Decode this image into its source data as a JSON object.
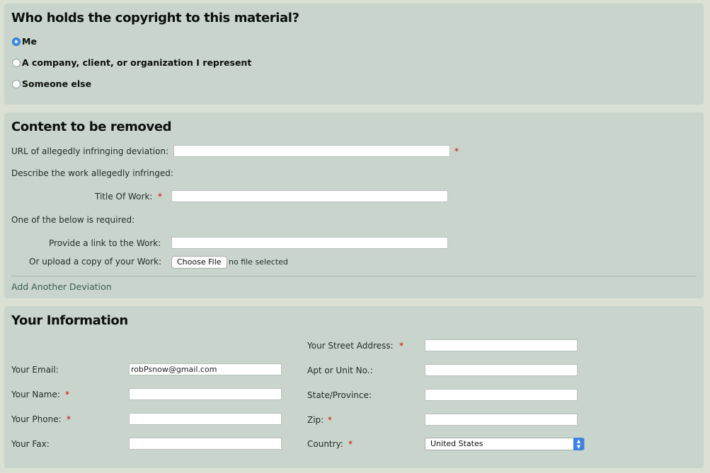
{
  "copyright": {
    "heading": "Who holds the copyright to this material?",
    "options": [
      {
        "label": "Me",
        "selected": true
      },
      {
        "label": "A company, client, or organization I represent",
        "selected": false
      },
      {
        "label": "Someone else",
        "selected": false
      }
    ]
  },
  "content": {
    "heading": "Content to be removed",
    "url_label": "URL of allegedly infringing deviation:",
    "url_value": "",
    "describe_label": "Describe the work allegedly infringed:",
    "title_label": "Title Of Work:",
    "title_value": "",
    "one_required": "One of the below is required:",
    "link_label": "Provide a link to the Work:",
    "link_value": "",
    "upload_label": "Or upload a copy of your Work:",
    "choose_file": "Choose File",
    "no_file": "no file selected",
    "add_another": "Add Another Deviation"
  },
  "info": {
    "heading": "Your Information",
    "required_mark": "*",
    "email_label": "Your Email:",
    "email_value": "robPsnow@gmail.com",
    "name_label": "Your Name:",
    "name_value": "",
    "phone_label": "Your Phone:",
    "phone_value": "",
    "fax_label": "Your Fax:",
    "fax_value": "",
    "street_label": "Your Street Address:",
    "street_value": "",
    "apt_label": "Apt or Unit No.:",
    "apt_value": "",
    "state_label": "State/Province:",
    "state_value": "",
    "zip_label": "Zip:",
    "zip_value": "",
    "country_label": "Country:",
    "country_value": "United States"
  },
  "colors": {
    "page_bg": "#dae0d4",
    "panel_bg": "#c9d5cc",
    "required": "#dd0000",
    "radio_selected": "#3b8ef0",
    "link": "#3a5f52"
  },
  "icons": {
    "select_arrow": "chevron-up-down-icon"
  }
}
